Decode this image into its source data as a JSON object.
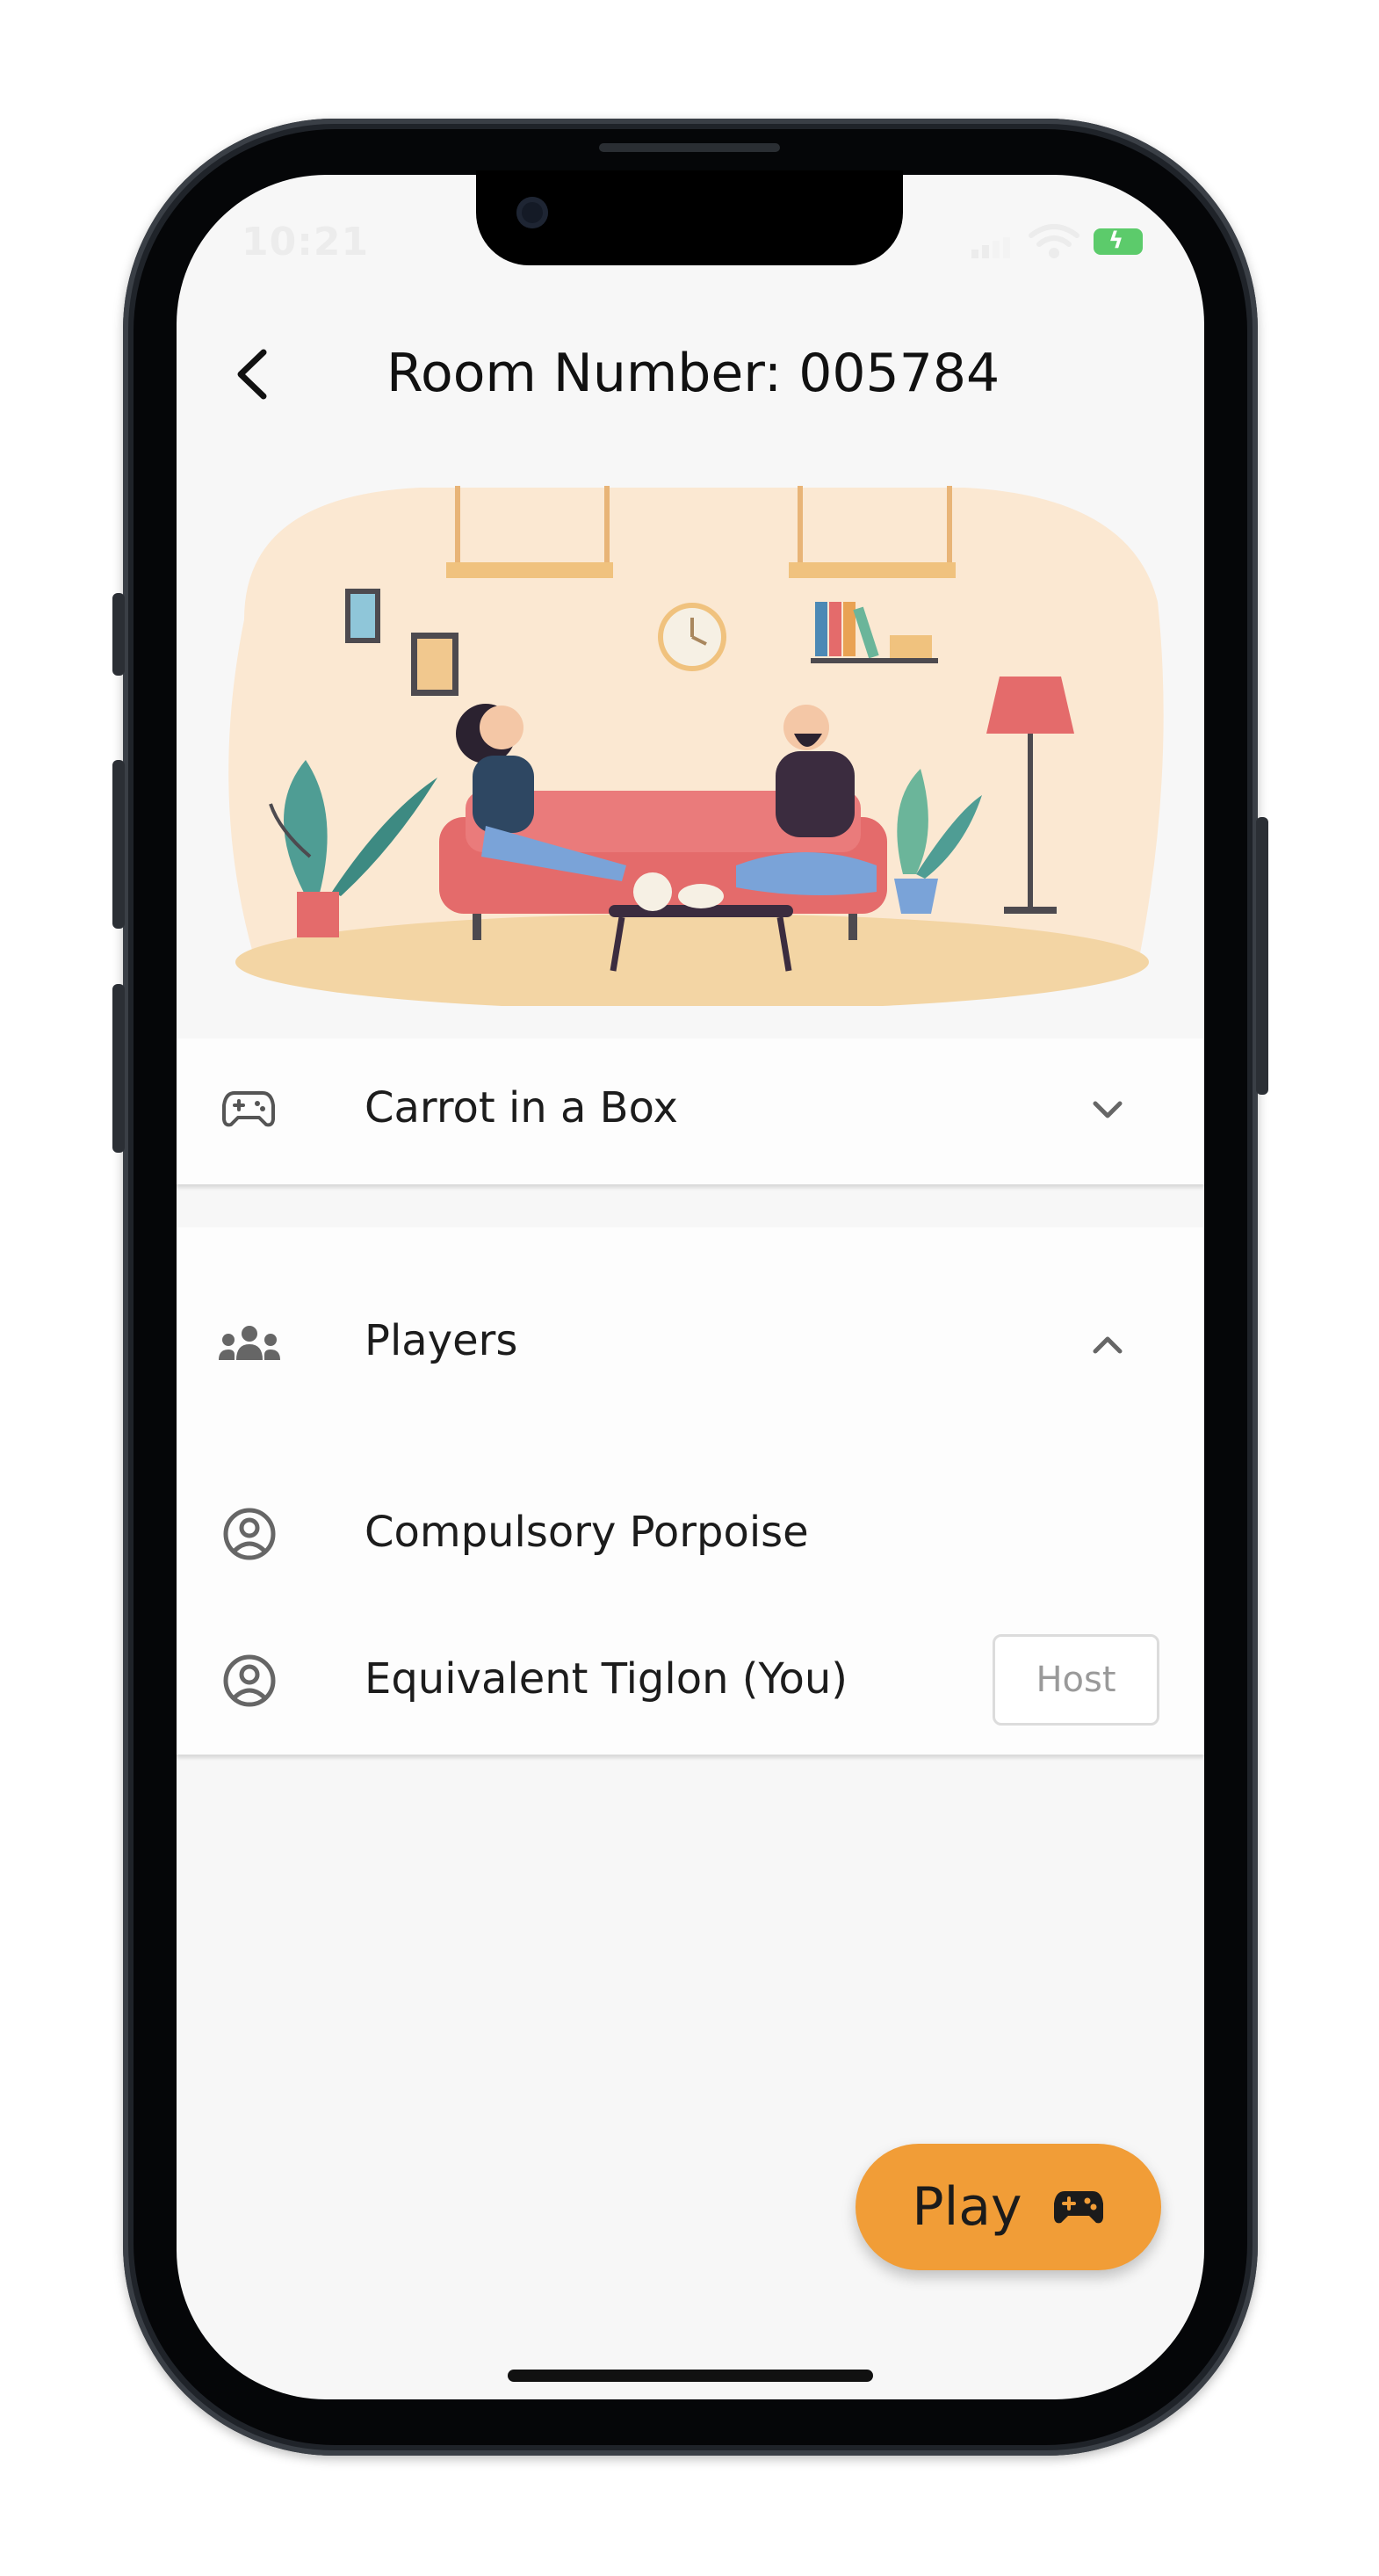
{
  "status_bar": {
    "time": "10:21"
  },
  "header": {
    "title": "Room Number: 005784"
  },
  "game_section": {
    "selected_game": "Carrot in a Box"
  },
  "players_section": {
    "title": "Players",
    "players": [
      {
        "name": "Compulsory Porpoise"
      },
      {
        "name": "Equivalent Tiglon (You)",
        "badge": "Host"
      }
    ]
  },
  "play_button": {
    "label": "Play"
  },
  "colors": {
    "accent": "#f19d37",
    "background": "#f7f7f7",
    "battery": "#5ccb6b"
  }
}
